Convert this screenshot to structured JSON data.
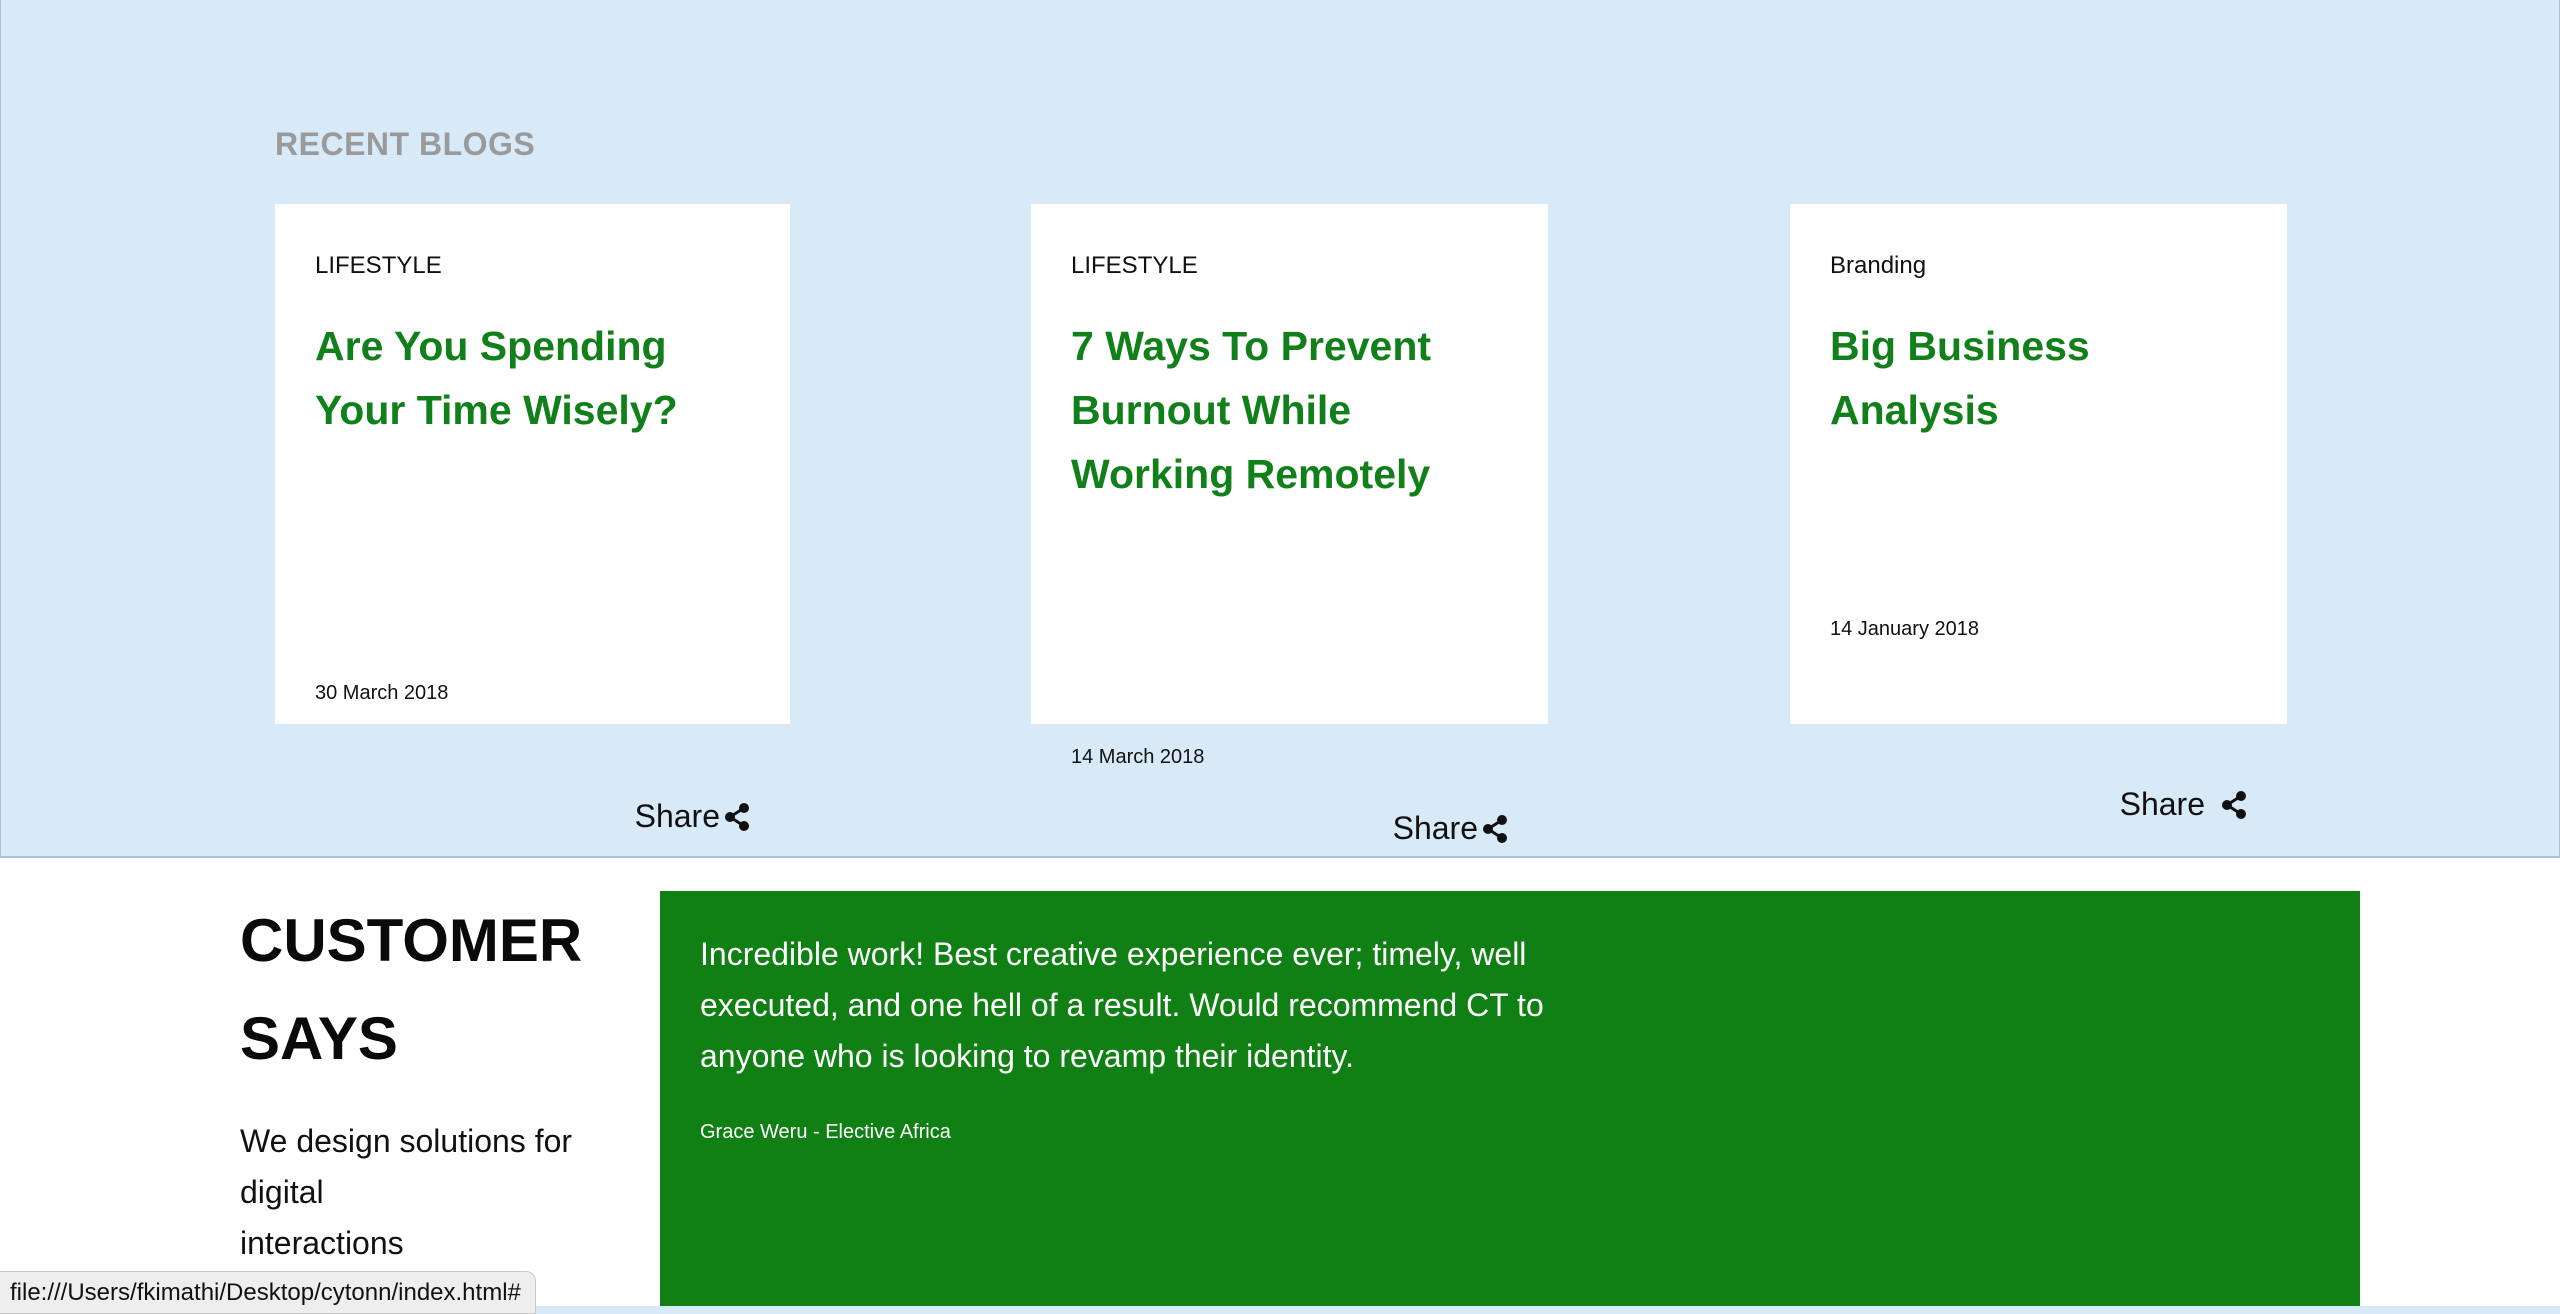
{
  "blogs": {
    "section_title": "RECENT BLOGS",
    "cards": [
      {
        "category": "LIFESTYLE",
        "title": "Are You Spending Your Time Wisely?",
        "date": "30 March 2018",
        "share_label": "Share"
      },
      {
        "category": "LIFESTYLE",
        "title": "7 Ways To Prevent Burnout While Working Remotely",
        "date": "14 March 2018",
        "share_label": "Share"
      },
      {
        "category": "Branding",
        "title": "Big Business Analysis",
        "date": "14 January 2018",
        "share_label": "Share"
      }
    ],
    "share_icon": "share-icon"
  },
  "customer": {
    "title_line1": "CUSTOMER",
    "title_line2": "SAYS",
    "subtitle_line1": "We design solutions for",
    "subtitle_line2": "digital",
    "subtitle_line3": "interactions"
  },
  "testimonial": {
    "quote": "Incredible work! Best creative experience ever; timely, well executed, and one hell of a result. Would recommend CT to anyone who is looking to revamp their identity.",
    "author": "Grace Weru - Elective Africa"
  },
  "status_bar": {
    "url": "file:///Users/fkimathi/Desktop/cytonn/index.html#"
  },
  "colors": {
    "blogs_background": "#d8eaf8",
    "title_green": "#12801a",
    "testimonial_green": "#118014"
  }
}
